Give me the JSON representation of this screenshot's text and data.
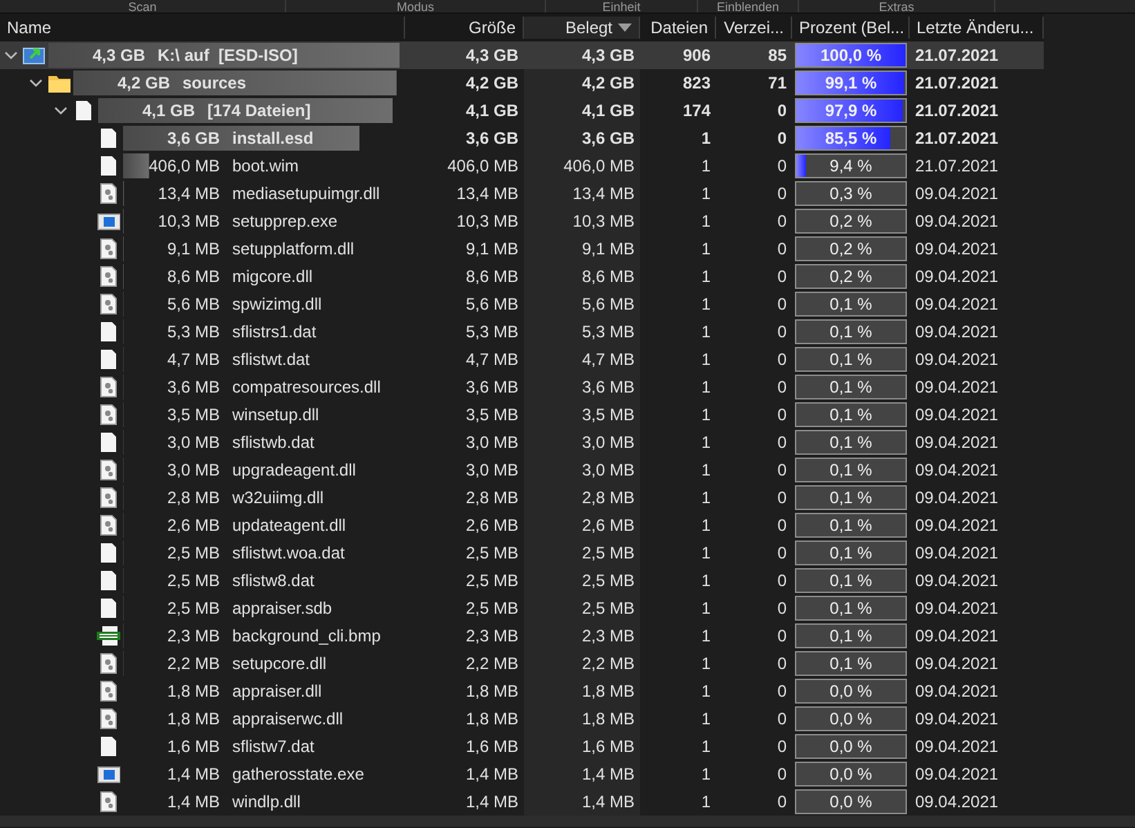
{
  "ribbon_groups": [
    "Scan",
    "Modus",
    "Einheit",
    "Einblenden",
    "Extras"
  ],
  "columns": [
    {
      "label": "Name",
      "sorted": false
    },
    {
      "label": "Größe",
      "sorted": false
    },
    {
      "label": "Belegt",
      "sorted": true
    },
    {
      "label": "Dateien",
      "sorted": false
    },
    {
      "label": "Verzei...",
      "sorted": false
    },
    {
      "label": "Prozent (Bel...",
      "sorted": false
    },
    {
      "label": "Letzte Änderu...",
      "sorted": false
    }
  ],
  "tree": [
    {
      "kind": "drive",
      "size_label": "4,3 GB",
      "name": "K:\\ auf  [ESD-ISO]",
      "size": "4,3 GB",
      "allocated": "4,3 GB",
      "files": "906",
      "folders": "85",
      "percent": "100,0 %",
      "level": 1.0,
      "modified": "21.07.2021",
      "emphasized": true,
      "selected": true,
      "expanded": true,
      "children": [
        {
          "kind": "folder",
          "size_label": "4,2 GB",
          "name": "sources",
          "size": "4,2 GB",
          "allocated": "4,2 GB",
          "files": "823",
          "folders": "71",
          "percent": "99,1 %",
          "level": 0.991,
          "modified": "21.07.2021",
          "emphasized": true,
          "selected": false,
          "expanded": true,
          "children": [
            {
              "kind": "file_group",
              "size_label": "4,1 GB",
              "name": "[174 Dateien]",
              "size": "4,1 GB",
              "allocated": "4,1 GB",
              "files": "174",
              "folders": "0",
              "percent": "97,9 %",
              "level": 0.979,
              "modified": "21.07.2021",
              "emphasized": true,
              "selected": false,
              "expanded": true,
              "children": [
                {
                  "kind": "file",
                  "size_label": "3,6 GB",
                  "name": "install.esd",
                  "size": "3,6 GB",
                  "allocated": "3,6 GB",
                  "files": "1",
                  "folders": "0",
                  "percent": "85,5 %",
                  "level": 0.855,
                  "modified": "21.07.2021",
                  "emphasized": true,
                  "selected": false
                },
                {
                  "kind": "file",
                  "size_label": "406,0 MB",
                  "name": "boot.wim",
                  "size": "406,0 MB",
                  "allocated": "406,0 MB",
                  "files": "1",
                  "folders": "0",
                  "percent": "9,4 %",
                  "level": 0.094,
                  "modified": "21.07.2021",
                  "emphasized": false,
                  "selected": false
                },
                {
                  "kind": "dll",
                  "size_label": "13,4 MB",
                  "name": "mediasetupuimgr.dll",
                  "size": "13,4 MB",
                  "allocated": "13,4 MB",
                  "files": "1",
                  "folders": "0",
                  "percent": "0,3 %",
                  "level": 0.003,
                  "modified": "09.04.2021",
                  "emphasized": false,
                  "selected": false
                },
                {
                  "kind": "exe",
                  "size_label": "10,3 MB",
                  "name": "setupprep.exe",
                  "size": "10,3 MB",
                  "allocated": "10,3 MB",
                  "files": "1",
                  "folders": "0",
                  "percent": "0,2 %",
                  "level": 0.002,
                  "modified": "09.04.2021",
                  "emphasized": false,
                  "selected": false
                },
                {
                  "kind": "dll",
                  "size_label": "9,1 MB",
                  "name": "setupplatform.dll",
                  "size": "9,1 MB",
                  "allocated": "9,1 MB",
                  "files": "1",
                  "folders": "0",
                  "percent": "0,2 %",
                  "level": 0.002,
                  "modified": "09.04.2021",
                  "emphasized": false,
                  "selected": false
                },
                {
                  "kind": "dll",
                  "size_label": "8,6 MB",
                  "name": "migcore.dll",
                  "size": "8,6 MB",
                  "allocated": "8,6 MB",
                  "files": "1",
                  "folders": "0",
                  "percent": "0,2 %",
                  "level": 0.002,
                  "modified": "09.04.2021",
                  "emphasized": false,
                  "selected": false
                },
                {
                  "kind": "dll",
                  "size_label": "5,6 MB",
                  "name": "spwizimg.dll",
                  "size": "5,6 MB",
                  "allocated": "5,6 MB",
                  "files": "1",
                  "folders": "0",
                  "percent": "0,1 %",
                  "level": 0.001,
                  "modified": "09.04.2021",
                  "emphasized": false,
                  "selected": false
                },
                {
                  "kind": "file",
                  "size_label": "5,3 MB",
                  "name": "sflistrs1.dat",
                  "size": "5,3 MB",
                  "allocated": "5,3 MB",
                  "files": "1",
                  "folders": "0",
                  "percent": "0,1 %",
                  "level": 0.001,
                  "modified": "09.04.2021",
                  "emphasized": false,
                  "selected": false
                },
                {
                  "kind": "file",
                  "size_label": "4,7 MB",
                  "name": "sflistwt.dat",
                  "size": "4,7 MB",
                  "allocated": "4,7 MB",
                  "files": "1",
                  "folders": "0",
                  "percent": "0,1 %",
                  "level": 0.001,
                  "modified": "09.04.2021",
                  "emphasized": false,
                  "selected": false
                },
                {
                  "kind": "dll",
                  "size_label": "3,6 MB",
                  "name": "compatresources.dll",
                  "size": "3,6 MB",
                  "allocated": "3,6 MB",
                  "files": "1",
                  "folders": "0",
                  "percent": "0,1 %",
                  "level": 0.001,
                  "modified": "09.04.2021",
                  "emphasized": false,
                  "selected": false
                },
                {
                  "kind": "dll",
                  "size_label": "3,5 MB",
                  "name": "winsetup.dll",
                  "size": "3,5 MB",
                  "allocated": "3,5 MB",
                  "files": "1",
                  "folders": "0",
                  "percent": "0,1 %",
                  "level": 0.001,
                  "modified": "09.04.2021",
                  "emphasized": false,
                  "selected": false
                },
                {
                  "kind": "file",
                  "size_label": "3,0 MB",
                  "name": "sflistwb.dat",
                  "size": "3,0 MB",
                  "allocated": "3,0 MB",
                  "files": "1",
                  "folders": "0",
                  "percent": "0,1 %",
                  "level": 0.001,
                  "modified": "09.04.2021",
                  "emphasized": false,
                  "selected": false
                },
                {
                  "kind": "dll",
                  "size_label": "3,0 MB",
                  "name": "upgradeagent.dll",
                  "size": "3,0 MB",
                  "allocated": "3,0 MB",
                  "files": "1",
                  "folders": "0",
                  "percent": "0,1 %",
                  "level": 0.001,
                  "modified": "09.04.2021",
                  "emphasized": false,
                  "selected": false
                },
                {
                  "kind": "dll",
                  "size_label": "2,8 MB",
                  "name": "w32uiimg.dll",
                  "size": "2,8 MB",
                  "allocated": "2,8 MB",
                  "files": "1",
                  "folders": "0",
                  "percent": "0,1 %",
                  "level": 0.001,
                  "modified": "09.04.2021",
                  "emphasized": false,
                  "selected": false
                },
                {
                  "kind": "dll",
                  "size_label": "2,6 MB",
                  "name": "updateagent.dll",
                  "size": "2,6 MB",
                  "allocated": "2,6 MB",
                  "files": "1",
                  "folders": "0",
                  "percent": "0,1 %",
                  "level": 0.001,
                  "modified": "09.04.2021",
                  "emphasized": false,
                  "selected": false
                },
                {
                  "kind": "file",
                  "size_label": "2,5 MB",
                  "name": "sflistwt.woa.dat",
                  "size": "2,5 MB",
                  "allocated": "2,5 MB",
                  "files": "1",
                  "folders": "0",
                  "percent": "0,1 %",
                  "level": 0.001,
                  "modified": "09.04.2021",
                  "emphasized": false,
                  "selected": false
                },
                {
                  "kind": "file",
                  "size_label": "2,5 MB",
                  "name": "sflistw8.dat",
                  "size": "2,5 MB",
                  "allocated": "2,5 MB",
                  "files": "1",
                  "folders": "0",
                  "percent": "0,1 %",
                  "level": 0.001,
                  "modified": "09.04.2021",
                  "emphasized": false,
                  "selected": false
                },
                {
                  "kind": "file",
                  "size_label": "2,5 MB",
                  "name": "appraiser.sdb",
                  "size": "2,5 MB",
                  "allocated": "2,5 MB",
                  "files": "1",
                  "folders": "0",
                  "percent": "0,1 %",
                  "level": 0.001,
                  "modified": "09.04.2021",
                  "emphasized": false,
                  "selected": false
                },
                {
                  "kind": "bmp",
                  "size_label": "2,3 MB",
                  "name": "background_cli.bmp",
                  "size": "2,3 MB",
                  "allocated": "2,3 MB",
                  "files": "1",
                  "folders": "0",
                  "percent": "0,1 %",
                  "level": 0.001,
                  "modified": "09.04.2021",
                  "emphasized": false,
                  "selected": false
                },
                {
                  "kind": "dll",
                  "size_label": "2,2 MB",
                  "name": "setupcore.dll",
                  "size": "2,2 MB",
                  "allocated": "2,2 MB",
                  "files": "1",
                  "folders": "0",
                  "percent": "0,1 %",
                  "level": 0.001,
                  "modified": "09.04.2021",
                  "emphasized": false,
                  "selected": false
                },
                {
                  "kind": "dll",
                  "size_label": "1,8 MB",
                  "name": "appraiser.dll",
                  "size": "1,8 MB",
                  "allocated": "1,8 MB",
                  "files": "1",
                  "folders": "0",
                  "percent": "0,0 %",
                  "level": 0.0,
                  "modified": "09.04.2021",
                  "emphasized": false,
                  "selected": false
                },
                {
                  "kind": "dll",
                  "size_label": "1,8 MB",
                  "name": "appraiserwc.dll",
                  "size": "1,8 MB",
                  "allocated": "1,8 MB",
                  "files": "1",
                  "folders": "0",
                  "percent": "0,0 %",
                  "level": 0.0,
                  "modified": "09.04.2021",
                  "emphasized": false,
                  "selected": false
                },
                {
                  "kind": "file",
                  "size_label": "1,6 MB",
                  "name": "sflistw7.dat",
                  "size": "1,6 MB",
                  "allocated": "1,6 MB",
                  "files": "1",
                  "folders": "0",
                  "percent": "0,0 %",
                  "level": 0.0,
                  "modified": "09.04.2021",
                  "emphasized": false,
                  "selected": false
                },
                {
                  "kind": "exe",
                  "size_label": "1,4 MB",
                  "name": "gatherosstate.exe",
                  "size": "1,4 MB",
                  "allocated": "1,4 MB",
                  "files": "1",
                  "folders": "0",
                  "percent": "0,0 %",
                  "level": 0.0,
                  "modified": "09.04.2021",
                  "emphasized": false,
                  "selected": false
                },
                {
                  "kind": "dll",
                  "size_label": "1,4 MB",
                  "name": "windlp.dll",
                  "size": "1,4 MB",
                  "allocated": "1,4 MB",
                  "files": "1",
                  "folders": "0",
                  "percent": "0,0 %",
                  "level": 0.0,
                  "modified": "09.04.2021",
                  "emphasized": false,
                  "selected": false
                }
              ]
            }
          ]
        }
      ]
    }
  ]
}
